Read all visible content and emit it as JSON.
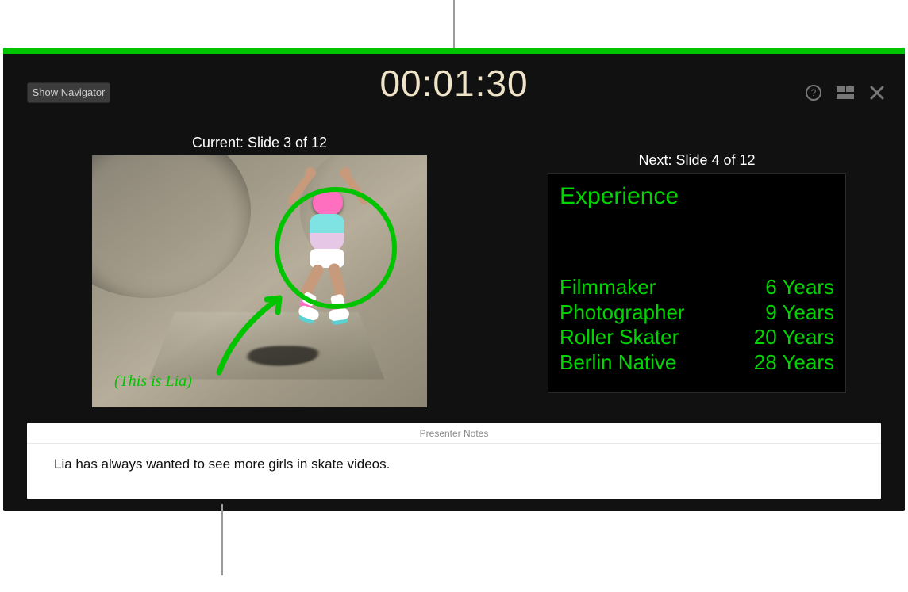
{
  "toolbar": {
    "show_navigator_label": "Show Navigator"
  },
  "timer": "00:01:30",
  "labels": {
    "current": "Current: Slide 3 of 12",
    "next": "Next: Slide 4 of 12"
  },
  "current_slide": {
    "annotation_caption": "(This is Lia)"
  },
  "next_slide": {
    "title": "Experience",
    "rows": [
      {
        "role": "Filmmaker",
        "years": "6 Years"
      },
      {
        "role": "Photographer",
        "years": "9 Years"
      },
      {
        "role": "Roller Skater",
        "years": "20 Years"
      },
      {
        "role": "Berlin Native",
        "years": "28 Years"
      }
    ]
  },
  "notes": {
    "header": "Presenter Notes",
    "body": "Lia has always wanted to see more girls in skate videos."
  },
  "icons": {
    "help": "help-icon",
    "layout": "layout-icon",
    "close": "close-icon"
  },
  "colors": {
    "accent": "#00c400",
    "timer": "#efe4c9"
  }
}
